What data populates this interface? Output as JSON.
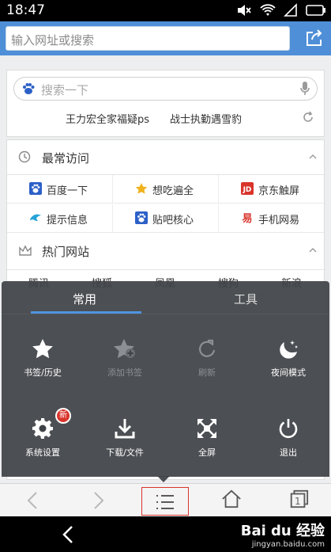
{
  "status": {
    "time": "18:47"
  },
  "url_bar": {
    "placeholder": "输入网址或搜索"
  },
  "search": {
    "placeholder": "搜索一下",
    "hot_words": [
      "王力宏全家福疑ps",
      "战士执勤遇雪豹"
    ]
  },
  "frequent": {
    "title": "最常访问",
    "sites": [
      [
        "百度一下",
        "想吃遍全",
        "京东触屏"
      ],
      [
        "提示信息",
        "贴吧核心",
        "手机网易"
      ]
    ]
  },
  "hot_sites": {
    "title": "热门网站",
    "sites": [
      "腾讯",
      "搜狐",
      "凤凰",
      "搜狗",
      "新浪"
    ]
  },
  "menu": {
    "tabs": [
      "常用",
      "工具"
    ],
    "items": [
      {
        "label": "书签/历史",
        "icon": "star-icon",
        "enabled": true
      },
      {
        "label": "添加书签",
        "icon": "star-plus-icon",
        "enabled": false
      },
      {
        "label": "刷新",
        "icon": "refresh-icon",
        "enabled": false
      },
      {
        "label": "夜间模式",
        "icon": "moon-icon",
        "enabled": true
      },
      {
        "label": "系统设置",
        "icon": "gear-icon",
        "enabled": true,
        "badge": "新"
      },
      {
        "label": "下载/文件",
        "icon": "download-icon",
        "enabled": true
      },
      {
        "label": "全屏",
        "icon": "fullscreen-icon",
        "enabled": true
      },
      {
        "label": "退出",
        "icon": "power-icon",
        "enabled": true
      }
    ]
  },
  "toolbar": {
    "tab_count": "1"
  },
  "watermark": {
    "main": "Bai du 经验",
    "sub": "jingyan.baidu.com"
  },
  "colors": {
    "accent": "#4f8fd8",
    "menu_bg": "#3e4246",
    "tab_underline": "#4f93e0",
    "badge": "#d9342b"
  }
}
